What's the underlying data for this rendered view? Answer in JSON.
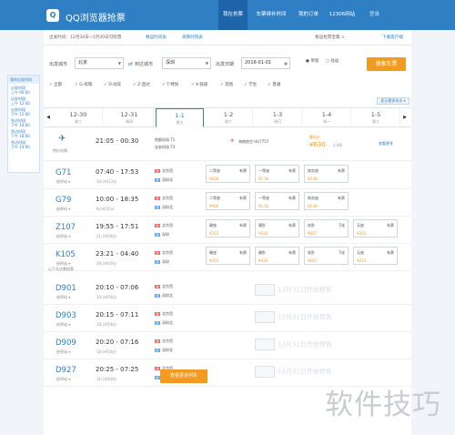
{
  "header": {
    "logo_glyph": "Q",
    "app_title": "QQ浏览器抢票",
    "nav": [
      "我在抢票",
      "车票候补时间",
      "我的订单",
      "12306网站"
    ],
    "login": "登录"
  },
  "tipbar": {
    "left": "出发时间：12月30日~1月30日可购票",
    "link1": "春运时间表",
    "link2": "高铁时刻表",
    "right": "春运抢票宝典 >",
    "right_link": "下载客户端"
  },
  "search": {
    "from_label": "出发城市",
    "from_value": "北京",
    "to_label": "到达城市",
    "to_value": "深圳",
    "date_label": "出发日期",
    "date_value": "2016-01-01",
    "one_way": "单程",
    "round_trip": "往返",
    "go_button": "搜索车票"
  },
  "filters": [
    "全部",
    "G-高铁",
    "D-动车",
    "Z-直达",
    "T-特快",
    "K-快速",
    "其他",
    "学生",
    "普通"
  ],
  "more_filter": "显示更多车次 ▾",
  "side_panel": {
    "title": "我的出发时间",
    "items": [
      {
        "line1": "出发时段",
        "line2": "上午 06:00"
      },
      {
        "line1": "出发时段",
        "line2": "上午 12:00"
      },
      {
        "line1": "出发时段",
        "line2": "下午 12:00"
      },
      {
        "line1": "到达时段",
        "line2": "下午 14:00"
      },
      {
        "line1": "到达时段",
        "line2": "下午 18:00"
      },
      {
        "line1": "到达时段",
        "line2": "下午 14:00"
      }
    ]
  },
  "dates": {
    "prev": "◀",
    "next": "▶",
    "items": [
      {
        "date": "12-30",
        "week": "周三"
      },
      {
        "date": "12-31",
        "week": "周四"
      },
      {
        "date": "1-1",
        "week": "周五"
      },
      {
        "date": "1-2",
        "week": "周六"
      },
      {
        "date": "1-3",
        "week": "周日"
      },
      {
        "date": "1-4",
        "week": "周一"
      },
      {
        "date": "1-5",
        "week": "周二"
      }
    ]
  },
  "flight": {
    "label": "特价机票",
    "time": "21:05 - 00:30",
    "from": "首都机场 T1",
    "to": "宝安机场 T3",
    "airline": "海南航空 HU7757",
    "badge": "最低价",
    "price": "¥630",
    "discount": "3.4折",
    "link": "查看更多"
  },
  "trains": [
    {
      "no": "G71",
      "sub": "经停站 ▾",
      "time": "07:40 - 17:53",
      "dur": "10小时13分",
      "from": "北京西",
      "to": "深圳北",
      "seats": [
        {
          "name": "二等座",
          "count": "有票",
          "price": "¥936"
        },
        {
          "name": "一等座",
          "count": "有票",
          "price": "¥1.5k"
        },
        {
          "name": "商务座",
          "count": "有票",
          "price": "¥2.8k"
        }
      ]
    },
    {
      "no": "G79",
      "sub": "经停站 ▾",
      "time": "10:00 - 18:35",
      "dur": "8小时35分",
      "from": "北京西",
      "to": "深圳北",
      "seats": [
        {
          "name": "二等座",
          "count": "有票",
          "price": "¥936"
        },
        {
          "name": "一等座",
          "count": "有票",
          "price": "¥1.5k"
        },
        {
          "name": "商务座",
          "count": "有票",
          "price": "¥2.8k"
        }
      ]
    },
    {
      "no": "Z107",
      "sub": "经停站 ▾",
      "time": "19:55 - 17:51",
      "dur": "21小时56分",
      "from": "北京西",
      "to": "深圳",
      "seats": [
        {
          "name": "硬座",
          "count": "有票",
          "price": "¥253"
        },
        {
          "name": "硬卧",
          "count": "有票",
          "price": "¥434"
        },
        {
          "name": "软卧",
          "count": "5张",
          "price": "¥667"
        },
        {
          "name": "无座",
          "count": "有票",
          "price": "¥253"
        }
      ]
    },
    {
      "no": "K105",
      "sub": "经停站 ▾",
      "time": "23:21 - 04:40",
      "dur": "29小时19分",
      "from": "北京西",
      "to": "深圳",
      "seats": [
        {
          "name": "硬座",
          "count": "有票",
          "price": "¥253"
        },
        {
          "name": "硬卧",
          "count": "有票",
          "price": "¥434"
        },
        {
          "name": "软卧",
          "count": "5张",
          "price": "¥667"
        },
        {
          "name": "无座",
          "count": "有票",
          "price": "¥253"
        }
      ]
    }
  ],
  "section_label": "以下车次需抢票",
  "sleeper_trains": [
    {
      "no": "D901",
      "sub": "经停站 ▾",
      "time": "20:10 - 07:06",
      "dur": "10小时56分",
      "from": "北京西",
      "to": "深圳北",
      "note": "12月31日开始预售"
    },
    {
      "no": "D903",
      "sub": "经停站 ▾",
      "time": "20:15 - 07:11",
      "dur": "10小时56分",
      "from": "北京西",
      "to": "深圳北",
      "note": "12月31日开始预售"
    },
    {
      "no": "D909",
      "sub": "经停站 ▾",
      "time": "20:20 - 07:16",
      "dur": "10小时56分",
      "from": "北京西",
      "to": "深圳北",
      "note": "12月31日开始预售"
    },
    {
      "no": "D927",
      "sub": "经停站 ▾",
      "time": "20:25 - 07:25",
      "dur": "11小时00分",
      "from": "北京西",
      "to": "深圳北",
      "note": "12月31日开始预售"
    }
  ],
  "bottom_button": "查看更多列车",
  "watermark": "软件技巧",
  "colors": {
    "brand": "#2f7fc4",
    "accent": "#f39a21"
  }
}
